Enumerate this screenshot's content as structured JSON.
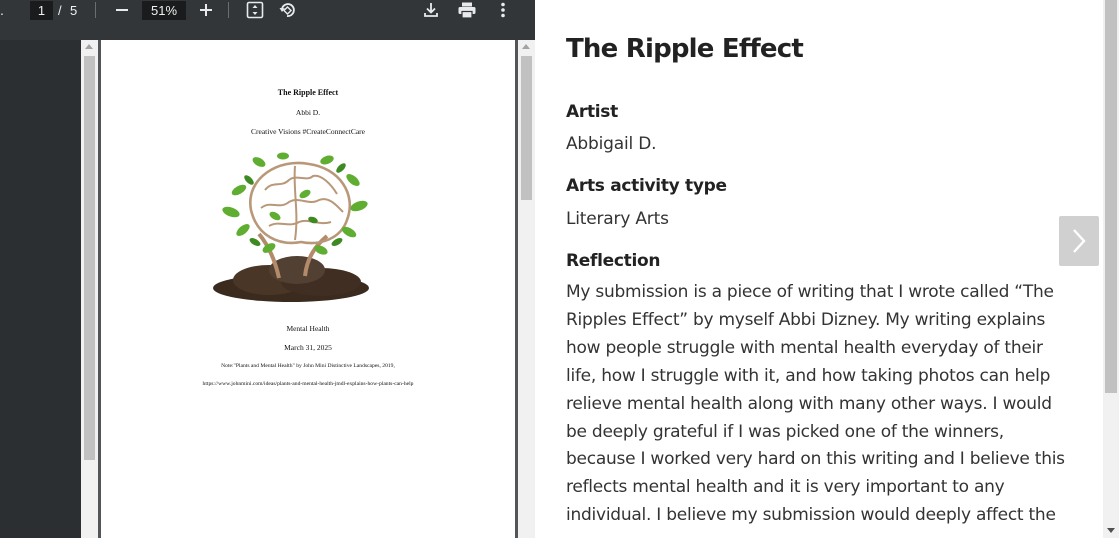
{
  "viewer": {
    "toolbar": {
      "page_current": "1",
      "page_separator": "/",
      "page_total": "5",
      "zoom": "51%",
      "icons": [
        "zoom-out-icon",
        "zoom-in-icon",
        "fit-page-icon",
        "rotate-icon",
        "download-icon",
        "print-icon",
        "more-vert-icon"
      ]
    },
    "page": {
      "title": "The Ripple Effect",
      "author": "Abbi D.",
      "subtitle": "Creative Visions #CreateConnectCare",
      "topic": "Mental Health",
      "date": "March 31, 2025",
      "note": "Note:\"Plants and Mental Health\" by John Mini Distinctive Landscapes, 2019,",
      "url": "https://www.johnmini.com/ideas/plants-and-mental-health-jmdl-explains-how-plants-can-help"
    }
  },
  "detail": {
    "title": "The Ripple Effect",
    "artist_label": "Artist",
    "artist_value": "Abbigail D.",
    "activity_label": "Arts activity type",
    "activity_value": "Literary Arts",
    "reflection_label": "Reflection",
    "reflection_lines": [
      "My submission is a piece of writing that I wrote called “The",
      "Ripples Effect” by myself Abbi Dizney. My writing explains",
      "how people struggle with mental health everyday of their",
      "life, how I struggle with it, and how taking photos can help",
      "relieve mental health along with many other ways. I would",
      "be deeply grateful if I was picked one of the winners,",
      "because I worked very hard on this writing and I believe this",
      "reflects mental health and it is very important to any",
      "individual. I believe my submission would deeply affect the"
    ]
  }
}
